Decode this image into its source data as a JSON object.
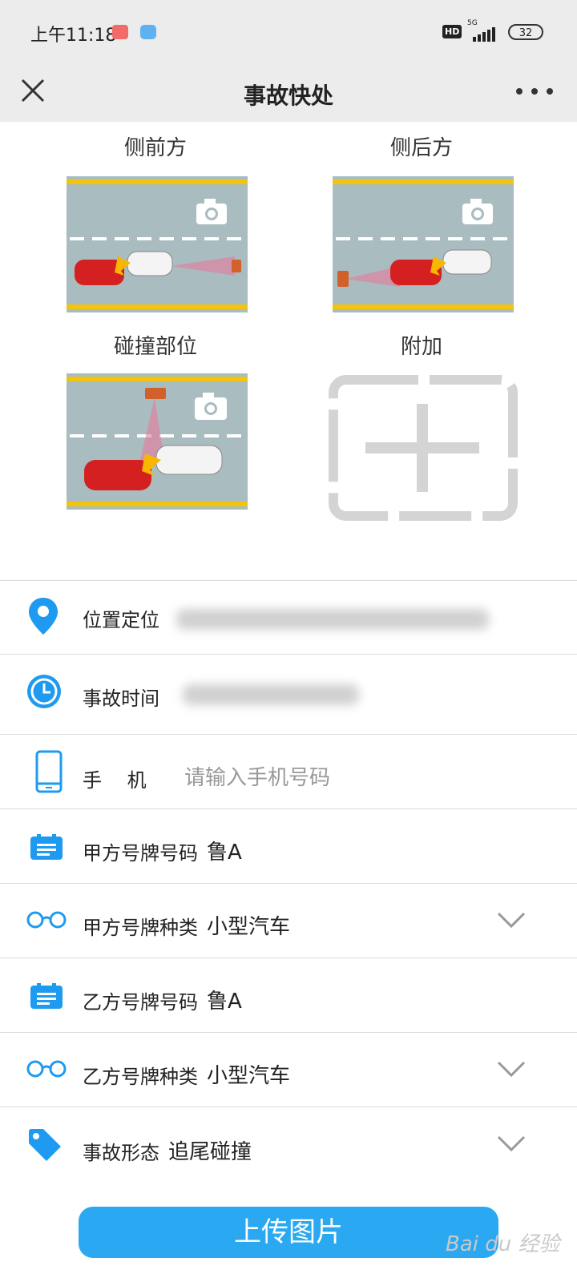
{
  "status_bar": {
    "time": "上午11:18",
    "network_badge": "HD",
    "network_type": "5G",
    "battery": "32"
  },
  "nav": {
    "title": "事故快处",
    "close_icon": "close-icon",
    "more_icon": "more-icon"
  },
  "photos": [
    {
      "label": "侧前方"
    },
    {
      "label": "侧后方"
    },
    {
      "label": "碰撞部位"
    },
    {
      "label": "附加"
    }
  ],
  "form": {
    "location": {
      "label": "位置定位",
      "icon": "location-pin-icon"
    },
    "accident_time": {
      "label": "事故时间",
      "icon": "clock-icon"
    },
    "phone": {
      "label": "手　 机",
      "placeholder": "请输入手机号码",
      "icon": "phone-icon"
    },
    "party_a_plate": {
      "label": "甲方号牌号码",
      "value": "鲁A",
      "icon": "id-card-icon"
    },
    "party_a_type": {
      "label": "甲方号牌种类",
      "value": "小型汽车",
      "icon": "glasses-icon"
    },
    "party_b_plate": {
      "label": "乙方号牌号码",
      "value": "鲁A",
      "icon": "id-card-icon"
    },
    "party_b_type": {
      "label": "乙方号牌种类",
      "value": "小型汽车",
      "icon": "glasses-icon"
    },
    "accident_form": {
      "label": "事故形态",
      "value": "追尾碰撞",
      "icon": "tag-icon"
    }
  },
  "upload_button": "上传图片",
  "watermark": "Bai du 经验",
  "colors": {
    "accent": "#2aa8f2",
    "road": "#a9bcbf",
    "lane_yellow": "#f2c40c",
    "car_red": "#d42020"
  }
}
